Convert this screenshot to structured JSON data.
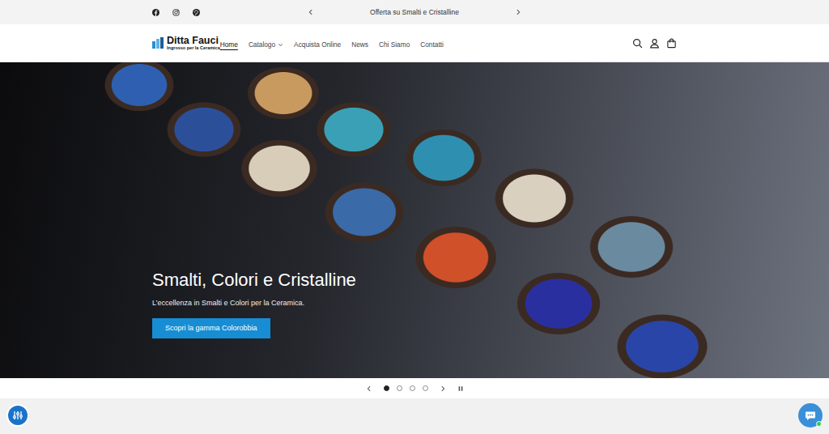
{
  "announcement": {
    "text": "Offerta su Smalti e Cristalline"
  },
  "logo": {
    "title": "Ditta Fauci",
    "subtitle": "Ingrosso per la Ceramica"
  },
  "nav": [
    {
      "label": "Home",
      "selected": true,
      "kind": "link"
    },
    {
      "label": "Catalogo",
      "selected": false,
      "kind": "dropdown"
    },
    {
      "label": "Acquista Online",
      "selected": false,
      "kind": "link"
    },
    {
      "label": "News",
      "selected": false,
      "kind": "link"
    },
    {
      "label": "Chi Siamo",
      "selected": false,
      "kind": "link"
    },
    {
      "label": "Contatti",
      "selected": false,
      "kind": "link"
    }
  ],
  "hero": {
    "title": "Smalti, Colori e Cristalline",
    "subtitle": "L’eccellenza in Smalti e Colori per la Ceramica.",
    "button": "Scopri la gamma Colorobbia"
  },
  "slider": {
    "dots": [
      {
        "selected": true
      },
      {
        "selected": false
      },
      {
        "selected": false
      },
      {
        "selected": false
      }
    ],
    "playing": true
  }
}
